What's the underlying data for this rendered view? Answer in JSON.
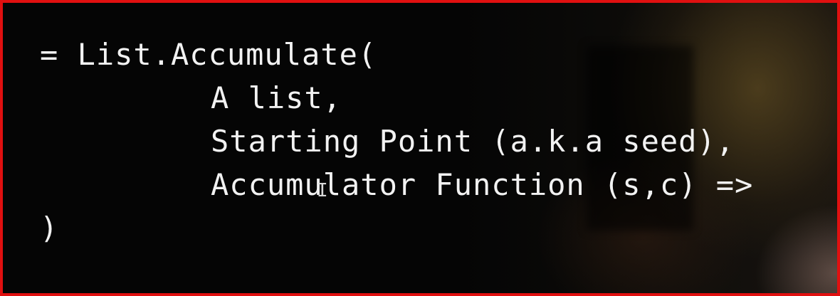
{
  "code": {
    "line1": "= List.Accumulate(",
    "line2": "A list,",
    "line3": "Starting Point (a.k.a seed),",
    "line4": "Accumulator Function (s,c) =>",
    "line5": ")"
  },
  "cursor": {
    "glyph": "I",
    "icon": "text-cursor-icon"
  },
  "colors": {
    "border": "#e01010",
    "text": "#f2f2f2",
    "background": "#030303"
  }
}
